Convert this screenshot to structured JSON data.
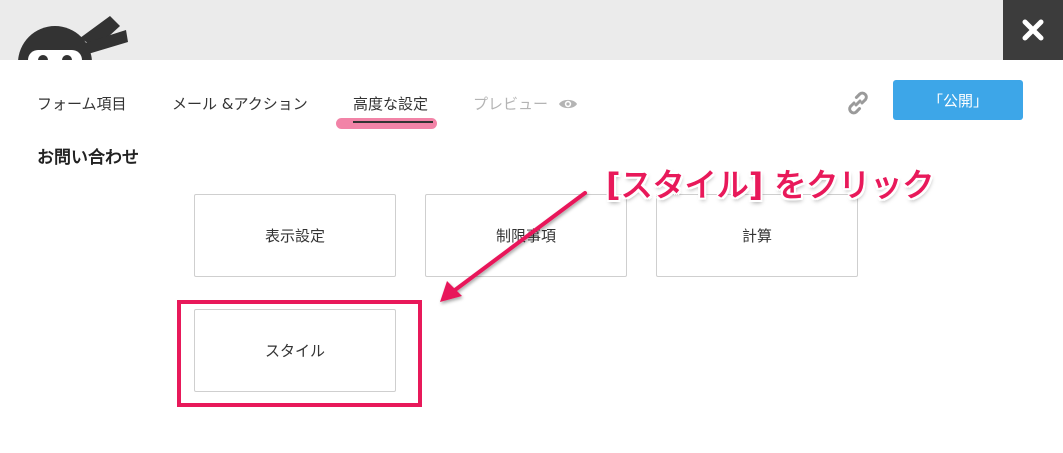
{
  "header": {
    "close_label": "✖"
  },
  "tabs": [
    {
      "label": "フォーム項目",
      "active": false
    },
    {
      "label": "メール &アクション",
      "active": false
    },
    {
      "label": "高度な設定",
      "active": true
    },
    {
      "label": "プレビュー",
      "active": false,
      "disabled": true
    }
  ],
  "actions": {
    "publish_label": "「公開」"
  },
  "form": {
    "title": "お問い合わせ"
  },
  "cards": [
    {
      "label": "表示設定"
    },
    {
      "label": "制限事項"
    },
    {
      "label": "計算"
    },
    {
      "label": "スタイル"
    }
  ],
  "annotation": {
    "text": "[スタイル] をクリック",
    "color": "#e8195a"
  },
  "colors": {
    "accent": "#3da6e8",
    "highlight": "#e8195a",
    "tab_underline": "#f06d98",
    "topbar": "#ebebeb",
    "close_bg": "#3c3c3c"
  },
  "icons": {
    "logo": "ninja-logo-icon",
    "close": "close-icon",
    "preview": "eye-icon",
    "link": "link-icon"
  }
}
